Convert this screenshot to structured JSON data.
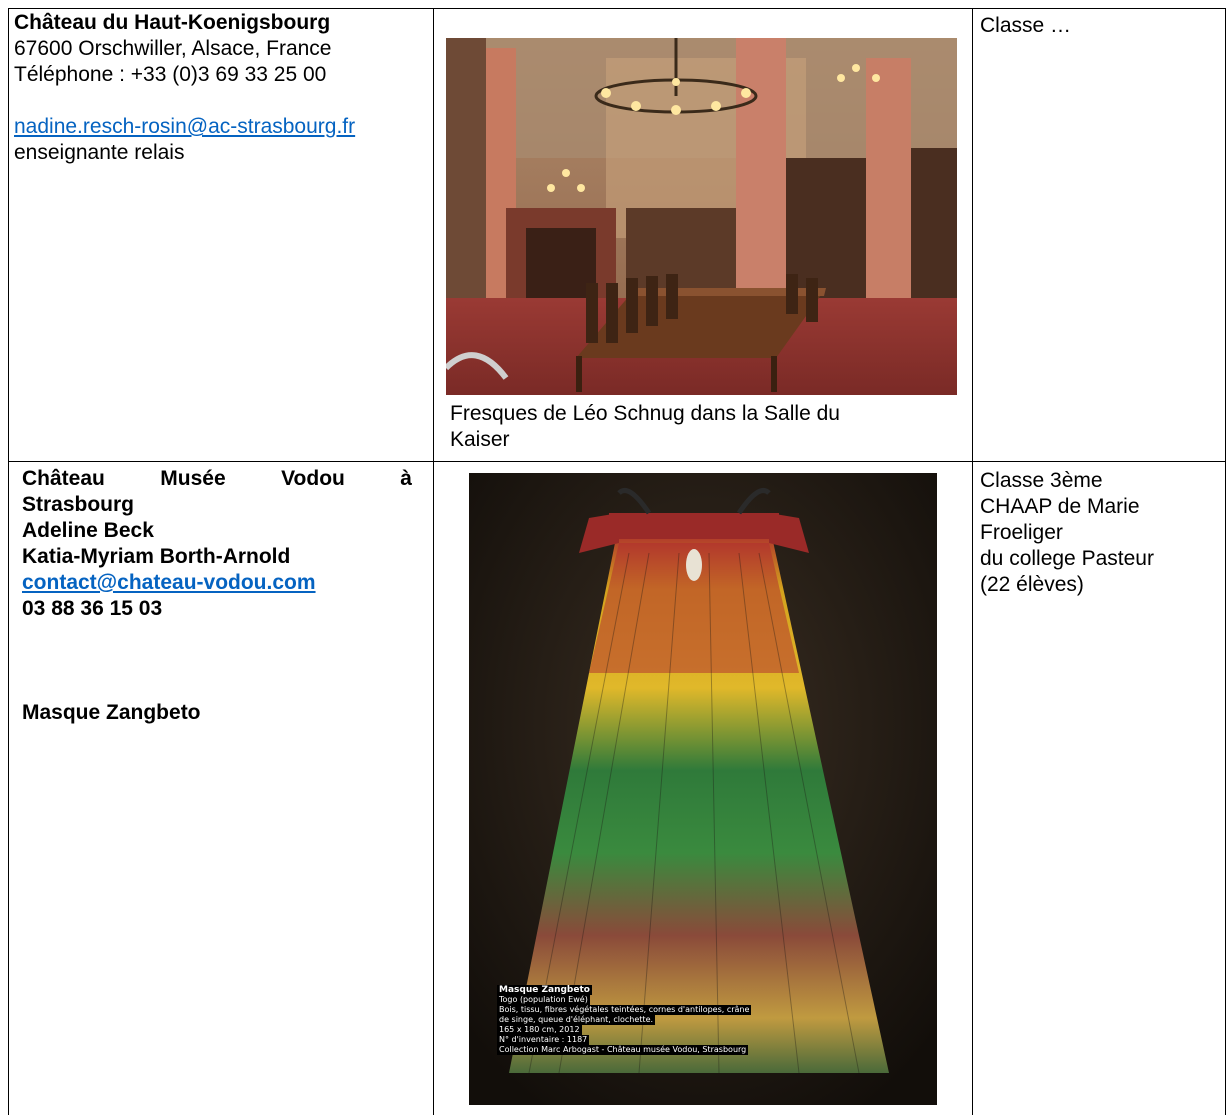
{
  "row1": {
    "venue": {
      "name": "Château du Haut-Koenigsbourg",
      "address": "67600 Orschwiller, Alsace, France",
      "phone": "Téléphone : +33 (0)3 69 33 25 00",
      "email": "nadine.resch-rosin@ac-strasbourg.fr",
      "role": "enseignante relais"
    },
    "image": {
      "caption_line1": "Fresques de Léo Schnug dans la Salle du",
      "caption_line2": "Kaiser"
    },
    "class_info": "Classe …"
  },
  "row2": {
    "venue": {
      "name_line1_words": [
        "Château",
        "Musée",
        "Vodou",
        "à"
      ],
      "name_line2": "Strasbourg",
      "contact1": "Adeline Beck",
      "contact2": "Katia-Myriam Borth-Arnold",
      "email": "contact@chateau-vodou.com",
      "phone": "03 88 36 15 03",
      "artwork": "Masque Zangbeto"
    },
    "image": {
      "placard": {
        "title": "Masque Zangbeto",
        "line1": "Togo (population Ewé)",
        "line2": "Bois, tissu, fibres végétales teintées, cornes d'antilopes, crâne",
        "line3": "de singe, queue d'éléphant, clochette.",
        "line4": "165 x 180 cm, 2012",
        "line5": "N° d'inventaire : 1187",
        "line6": "Collection Marc Arbogast - Château musée Vodou, Strasbourg"
      }
    },
    "class_info": {
      "line1": "Classe 3ème",
      "line2": "CHAAP de Marie",
      "line3": "Froeliger",
      "line4": "du college Pasteur",
      "line5": "(22 élèves)"
    }
  }
}
